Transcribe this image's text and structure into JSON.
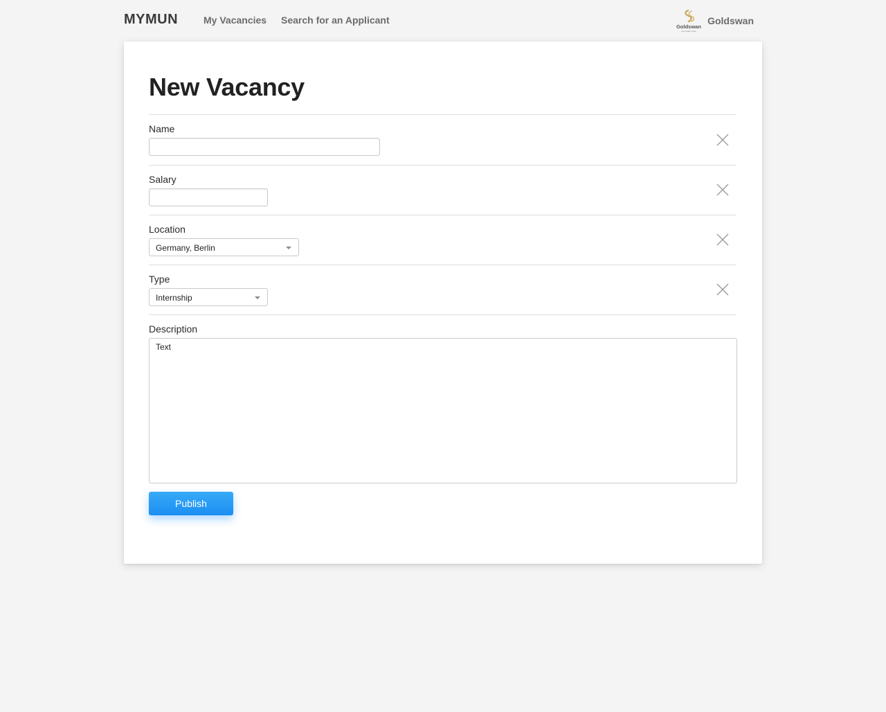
{
  "nav": {
    "brand": "MYMUN",
    "links": [
      "My Vacancies",
      "Search for an Applicant"
    ],
    "company_name": "Goldswan",
    "logo_text": "Goldswan",
    "logo_tagline": "Get Higher Now",
    "logo_color": "#c9a55a"
  },
  "page": {
    "title": "New Vacancy"
  },
  "form": {
    "name": {
      "label": "Name",
      "value": ""
    },
    "salary": {
      "label": "Salary",
      "value": ""
    },
    "location": {
      "label": "Location",
      "value": "Germany, Berlin"
    },
    "type": {
      "label": "Type",
      "value": "Internship"
    },
    "description": {
      "label": "Description",
      "value": "Text"
    },
    "publish_label": "Publish"
  },
  "colors": {
    "background": "#f4f4f4",
    "card": "#ffffff",
    "accent": "#2196f3",
    "nav_text": "#6b6b6b"
  }
}
